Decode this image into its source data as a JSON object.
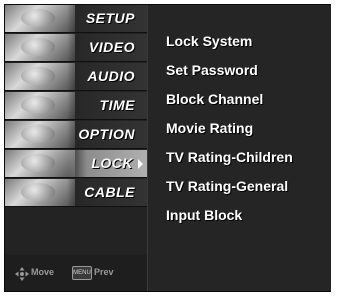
{
  "sidebar": {
    "items": [
      {
        "label": "SETUP"
      },
      {
        "label": "VIDEO"
      },
      {
        "label": "AUDIO"
      },
      {
        "label": "TIME"
      },
      {
        "label": "OPTION"
      },
      {
        "label": "LOCK",
        "selected": true
      },
      {
        "label": "CABLE"
      }
    ],
    "nav": {
      "move_label": "Move",
      "menu_key_label": "MENU",
      "prev_label": "Prev"
    }
  },
  "content": {
    "options": [
      {
        "label": "Lock System"
      },
      {
        "label": "Set Password"
      },
      {
        "label": "Block Channel"
      },
      {
        "label": "Movie Rating"
      },
      {
        "label": "TV Rating-Children"
      },
      {
        "label": "TV Rating-General"
      },
      {
        "label": "Input Block"
      }
    ]
  },
  "colors": {
    "frame": "#1b1b1b",
    "panel": "#252525",
    "selected_highlight": "#b0b0b0",
    "text": "#ffffff"
  }
}
